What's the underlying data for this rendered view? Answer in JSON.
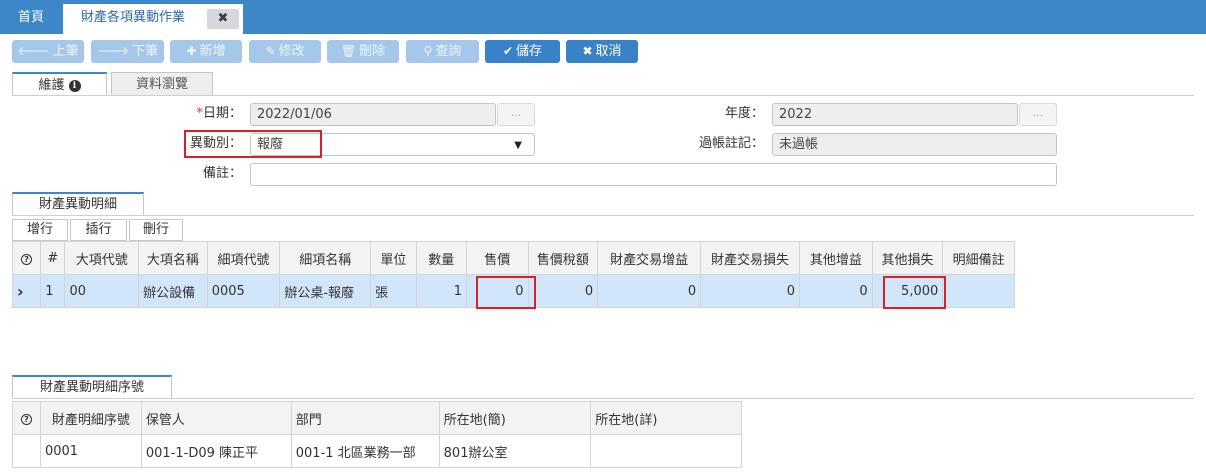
{
  "header": {
    "home_tab": "首頁",
    "active_tab": "財產各項異動作業",
    "close_glyph": "✖"
  },
  "toolbar": {
    "prev": "上筆",
    "prev_icon": "arrow-left-icon",
    "next": "下筆",
    "next_icon": "arrow-right-icon",
    "add": "新增",
    "add_icon": "plus-icon",
    "edit": "修改",
    "edit_icon": "pencil-icon",
    "delete": "刪除",
    "delete_icon": "trash-icon",
    "query": "查詢",
    "query_icon": "search-icon",
    "save": "儲存",
    "save_icon": "check-icon",
    "cancel": "取消",
    "cancel_icon": "x-icon"
  },
  "subtabs": {
    "maintain": "維護",
    "browse": "資料瀏覽"
  },
  "form": {
    "date_label": "日期：",
    "date_required": "*",
    "date_value": "2022/01/06",
    "date_btn": "...",
    "year_label": "年度：",
    "year_value": "2022",
    "year_btn": "...",
    "type_label": "異動別：",
    "type_value": "報廢",
    "posting_label": "過帳註記：",
    "posting_value": "未過帳",
    "note_label": "備註：",
    "note_value": ""
  },
  "detail": {
    "section_title": "財產異動明細",
    "row_buttons": [
      "增行",
      "插行",
      "刪行"
    ],
    "columns": [
      "#",
      "大項代號",
      "大項名稱",
      "細項代號",
      "細項名稱",
      "單位",
      "數量",
      "售價",
      "售價稅額",
      "財產交易增益",
      "財產交易損失",
      "其他增益",
      "其他損失",
      "明細備註"
    ],
    "rows": [
      [
        "1",
        "00",
        "辦公設備",
        "0005",
        "辦公桌-報廢",
        "張",
        "1",
        "0",
        "0",
        "0",
        "0",
        "0",
        "5,000",
        ""
      ]
    ]
  },
  "serial": {
    "section_title": "財產異動明細序號",
    "columns": [
      "財產明細序號",
      "保管人",
      "部門",
      "所在地(簡)",
      "所在地(詳)"
    ],
    "rows": [
      [
        "0001",
        "001-1-D09 陳正平",
        "001-1 北區業務一部",
        "801辦公室",
        ""
      ]
    ]
  },
  "colors": {
    "accent": "#3d87c9",
    "button": "#3a82c8",
    "button_disabled": "#a5c8ea",
    "highlight": "#d7202b",
    "selected_row": "#d2e6f9"
  }
}
